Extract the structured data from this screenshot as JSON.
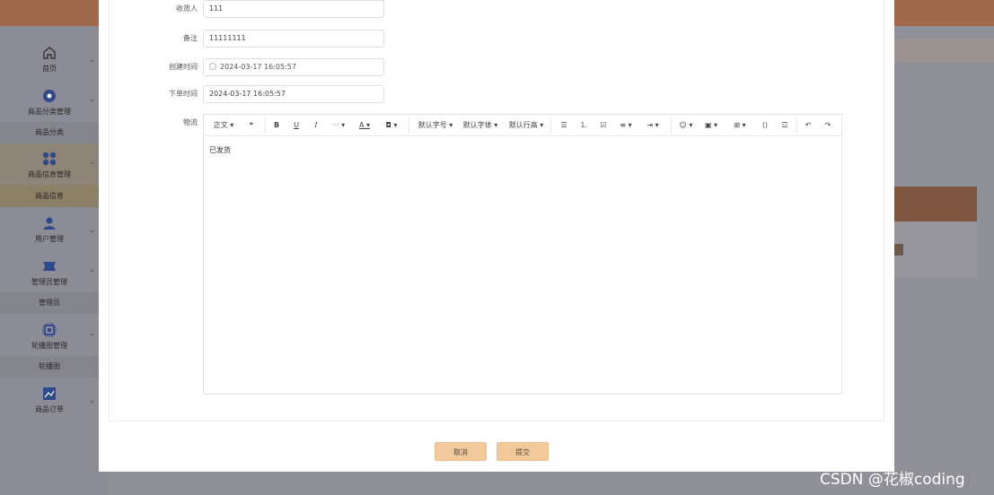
{
  "sidebar": {
    "items": [
      {
        "label": "首页",
        "icon": "home-icon"
      },
      {
        "label": "商品分类管理",
        "icon": "category-icon",
        "sub": "商品分类"
      },
      {
        "label": "商品信息管理",
        "icon": "grid-icon",
        "sub": "商品信息"
      },
      {
        "label": "用户管理",
        "icon": "user-icon"
      },
      {
        "label": "管理员管理",
        "icon": "admin-card-icon",
        "sub": "管理员"
      },
      {
        "label": "轮播图管理",
        "icon": "chip-icon",
        "sub": "轮播图"
      },
      {
        "label": "商品订单",
        "icon": "image-icon"
      }
    ]
  },
  "form": {
    "receiver": {
      "label": "收货人",
      "value": "111"
    },
    "remark": {
      "label": "备注",
      "value": "11111111"
    },
    "created_time": {
      "label": "创建时间",
      "value": "2024-03-17 16:05:57"
    },
    "order_time": {
      "label": "下单时间",
      "value": "2024-03-17 16:05:57"
    },
    "logistics": {
      "label": "物流",
      "content": "已发货"
    }
  },
  "toolbar": {
    "paragraph": "正文",
    "font_size": "默认字号",
    "font_family": "默认字体",
    "line_height": "默认行高"
  },
  "buttons": {
    "cancel": "取消",
    "submit": "提交"
  },
  "watermark": "CSDN @花椒coding",
  "colors": {
    "topbar": "#a0684a",
    "button": "#f2c99a",
    "sidebar_icon": "#2f4a8a"
  }
}
